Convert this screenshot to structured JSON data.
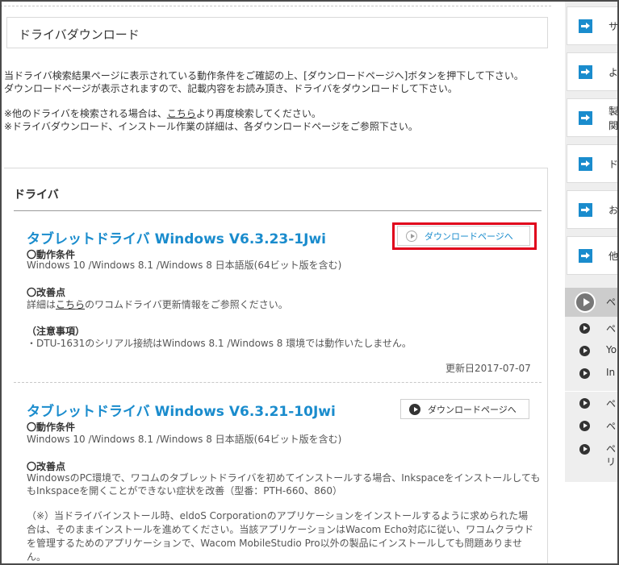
{
  "page": {
    "title": "ドライバダウンロード"
  },
  "intro": {
    "line1": "当ドライバ検索結果ページに表示されている動作条件をご確認の上、[ダウンロードページへ]ボタンを押下して下さい。",
    "line2": "ダウンロードページが表示されますので、記載内容をお読み頂き、ドライバをダウンロードして下さい。",
    "line3_prefix": "※他のドライバを検索される場合は、",
    "line3_link": "こちら",
    "line3_suffix": "より再度検索してください。",
    "line4": "※ドライバダウンロード、インストール作業の詳細は、各ダウンロードページをご参照下さい。"
  },
  "driver_section": {
    "heading": "ドライバ",
    "drivers": [
      {
        "title": "タブレットドライバ Windows V6.3.23-1Jwi",
        "button_label": "ダウンロードページへ",
        "requirements_label": "〇動作条件",
        "requirements": "Windows 10 /Windows 8.1 /Windows 8 日本語版(64ビット版を含む)",
        "improvements_label": "〇改善点",
        "improvements_prefix": "詳細は",
        "improvements_link": "こちら",
        "improvements_suffix": "のワコムドライバ更新情報をご参照ください。",
        "notes_label": "（注意事項）",
        "notes": "・DTU-1631のシリアル接続はWindows 8.1 /Windows 8 環境では動作いたしません。",
        "updated": "更新日2017-07-07"
      },
      {
        "title": "タブレットドライバ Windows V6.3.21-10Jwi",
        "button_label": "ダウンロードページへ",
        "requirements_label": "〇動作条件",
        "requirements": "Windows 10 /Windows 8.1 /Windows 8 日本語版(64ビット版を含む)",
        "improvements_label": "〇改善点",
        "improvements_line1": "WindowsのPC環境で、ワコムのタブレットドライバを初めてインストールする場合、Inkspaceをインストールしても",
        "improvements_line2": "もInkspaceを開くことができない症状を改善（型番：PTH-660、860）",
        "note_line1": "（※）当ドライバインストール時、eldoS Corporationのアプリケーションをインストールするように求められた場",
        "note_line2": "合は、そのままインストールを進めてください。当該アプリケーションはWacom Echo対応に従い、ワコムクラウド",
        "note_line3": "を管理するためのアプリケーションで、Wacom MobileStudio Pro以外の製品にインストールしても問題ありませ",
        "note_line4": "ん。"
      }
    ]
  },
  "sidebar": {
    "items": [
      {
        "label": "サ"
      },
      {
        "label": "よ"
      },
      {
        "label": "製\n関"
      },
      {
        "label": "ド"
      },
      {
        "label": "お"
      },
      {
        "label": "他"
      }
    ],
    "group1_head": "ペ",
    "group1": [
      {
        "label": "ペ"
      },
      {
        "label": "Yo"
      },
      {
        "label": "In"
      }
    ],
    "group2": [
      {
        "label": "ペ"
      },
      {
        "label": "ペ"
      },
      {
        "label": "ペ\nリ"
      }
    ]
  },
  "colors": {
    "link_blue": "#1a8ccd",
    "highlight_red": "#e0001b"
  }
}
